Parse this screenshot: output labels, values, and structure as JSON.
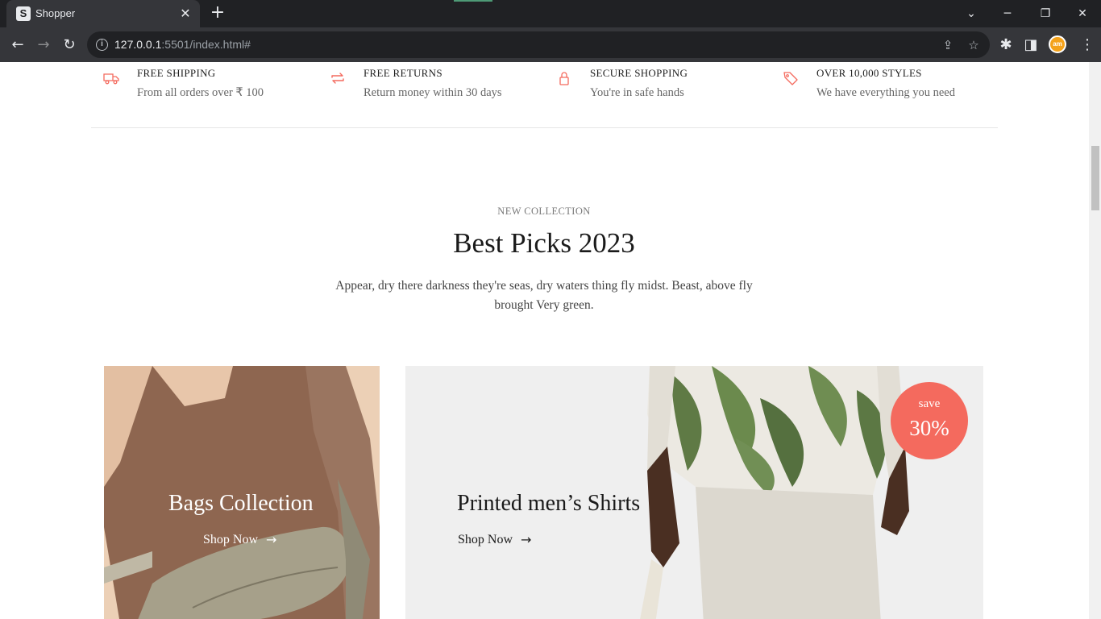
{
  "browser": {
    "tab_title": "Shopper",
    "tab_favicon": "S",
    "url_host": "127.0.0.1",
    "url_rest": ":5501/index.html#",
    "profile_initials": "am"
  },
  "features": [
    {
      "icon": "truck-icon",
      "title": "FREE SHIPPING",
      "subtitle": "From all orders over ₹ 100"
    },
    {
      "icon": "returns-icon",
      "title": "FREE RETURNS",
      "subtitle": "Return money within 30 days"
    },
    {
      "icon": "lock-icon",
      "title": "SECURE SHOPPING",
      "subtitle": "You're in safe hands"
    },
    {
      "icon": "tag-icon",
      "title": "OVER 10,000 STYLES",
      "subtitle": "We have everything you need"
    }
  ],
  "collection": {
    "eyebrow": "NEW COLLECTION",
    "heading": "Best Picks 2023",
    "description": "Appear, dry there darkness they're seas, dry waters thing fly midst. Beast, above fly brought Very green."
  },
  "cards": [
    {
      "title": "Bags Collection",
      "link": "Shop Now"
    },
    {
      "title": "Printed men’s Shirts",
      "link": "Shop Now",
      "badge_label": "save",
      "badge_value": "30%"
    }
  ],
  "colors": {
    "accent": "#f46a5e",
    "text": "#1a1a1a",
    "muted": "#666666"
  }
}
